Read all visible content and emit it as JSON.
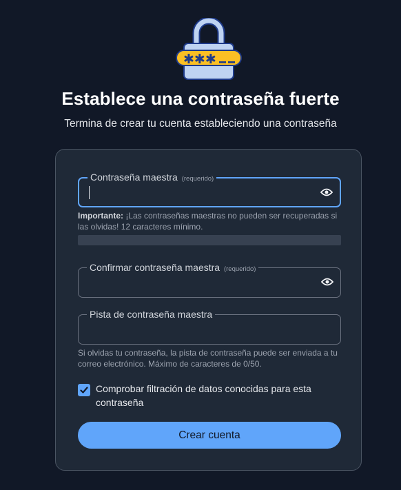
{
  "header": {
    "title": "Establece una contraseña fuerte",
    "subtitle": "Termina de crear tu cuenta estableciendo una contraseña",
    "logo_icon": "lock-password-icon"
  },
  "form": {
    "master_password": {
      "label": "Contraseña maestra",
      "required": "(requerido)",
      "value": ""
    },
    "password_help": {
      "important": "Importante:",
      "text": " ¡Las contraseñas maestras no pueden ser recuperadas si las olvidas! 12 caracteres mínimo."
    },
    "strength": 0,
    "confirm_password": {
      "label": "Confirmar contraseña maestra",
      "required": "(requerido)",
      "value": ""
    },
    "hint": {
      "label": "Pista de contraseña maestra",
      "value": "",
      "help": "Si olvidas tu contraseña, la pista de contraseña puede ser enviada a tu correo electrónico. Máximo de caracteres de 0/50."
    },
    "breach_check": {
      "checked": true,
      "label": "Comprobar filtración de datos conocidas para esta contraseña"
    },
    "submit_label": "Crear cuenta"
  },
  "colors": {
    "background": "#111827",
    "card": "#1f2937",
    "accent": "#60a5fa"
  }
}
